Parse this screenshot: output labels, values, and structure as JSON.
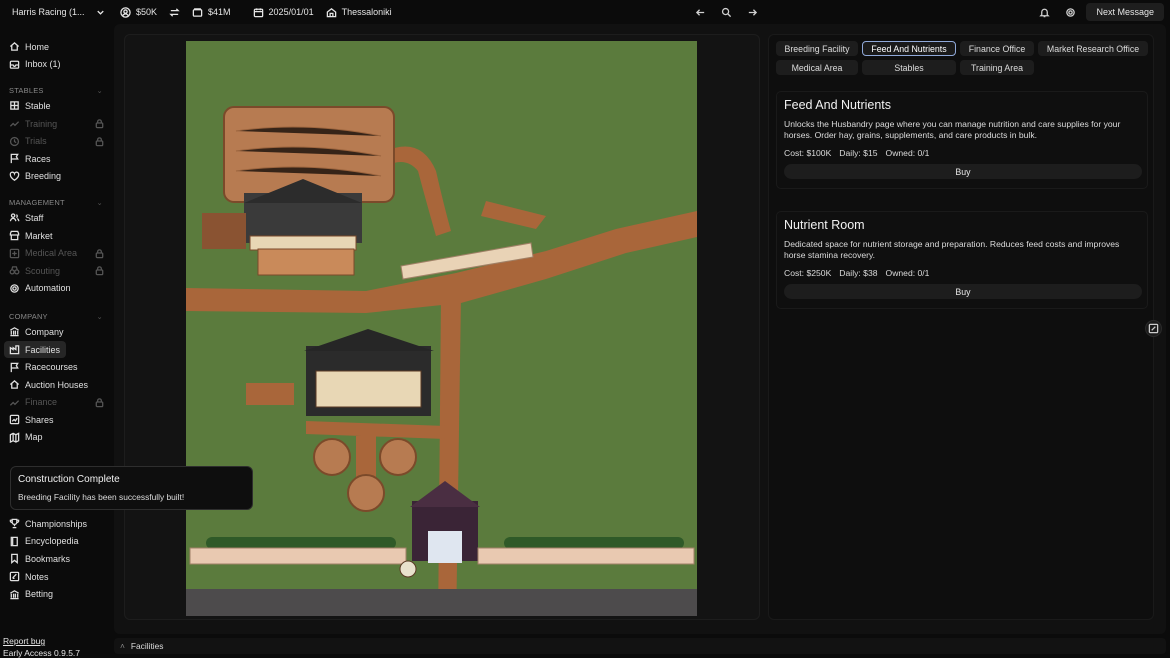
{
  "topbar": {
    "team": "Harris Racing (1...",
    "balance": "$50K",
    "net_worth": "$41M",
    "date": "2025/01/01",
    "location": "Thessaloniki",
    "next_message": "Next Message"
  },
  "sidebar": {
    "top": [
      {
        "label": "Home",
        "icon": "home-icon"
      },
      {
        "label": "Inbox (1)",
        "icon": "inbox-icon"
      }
    ],
    "sections": [
      {
        "title": "STABLES",
        "items": [
          {
            "label": "Stable",
            "enabled": true
          },
          {
            "label": "Training",
            "enabled": false
          },
          {
            "label": "Trials",
            "enabled": false
          },
          {
            "label": "Races",
            "enabled": true
          },
          {
            "label": "Breeding",
            "enabled": true
          }
        ]
      },
      {
        "title": "MANAGEMENT",
        "items": [
          {
            "label": "Staff",
            "enabled": true
          },
          {
            "label": "Market",
            "enabled": true
          },
          {
            "label": "Medical Area",
            "enabled": false
          },
          {
            "label": "Scouting",
            "enabled": false
          },
          {
            "label": "Automation",
            "enabled": true
          }
        ]
      },
      {
        "title": "COMPANY",
        "items": [
          {
            "label": "Company",
            "enabled": true
          },
          {
            "label": "Facilities",
            "enabled": true,
            "active": true
          },
          {
            "label": "Racecourses",
            "enabled": true
          },
          {
            "label": "Auction Houses",
            "enabled": true
          },
          {
            "label": "Finance",
            "enabled": false
          },
          {
            "label": "Shares",
            "enabled": true
          },
          {
            "label": "Map",
            "enabled": true
          }
        ]
      }
    ],
    "bottom": [
      {
        "label": "Championships"
      },
      {
        "label": "Encyclopedia"
      },
      {
        "label": "Bookmarks"
      },
      {
        "label": "Notes"
      },
      {
        "label": "Betting"
      }
    ],
    "report_bug": "Report bug",
    "version": "Early Access 0.9.5.7"
  },
  "tabs": [
    {
      "label": "Breeding Facility"
    },
    {
      "label": "Feed And Nutrients",
      "active": true
    },
    {
      "label": "Finance Office"
    },
    {
      "label": "Market Research Office"
    },
    {
      "label": "Medical Area"
    },
    {
      "label": "Stables"
    },
    {
      "label": "Training Area"
    }
  ],
  "cards": [
    {
      "title": "Feed And Nutrients",
      "description": "Unlocks the Husbandry page where you can manage nutrition and care supplies for your horses. Order hay, grains, supplements, and care products in bulk.",
      "cost": "Cost: $100K",
      "daily": "Daily: $15",
      "owned": "Owned: 0/1",
      "button": "Buy"
    },
    {
      "title": "Nutrient Room",
      "description": "Dedicated space for nutrient storage and preparation. Reduces feed costs and improves horse stamina recovery.",
      "cost": "Cost: $250K",
      "daily": "Daily: $38",
      "owned": "Owned: 0/1",
      "button": "Buy"
    }
  ],
  "toast": {
    "title": "Construction Complete",
    "message": "Breeding Facility has been successfully built!"
  },
  "statusbar": {
    "breadcrumb": "Facilities"
  }
}
